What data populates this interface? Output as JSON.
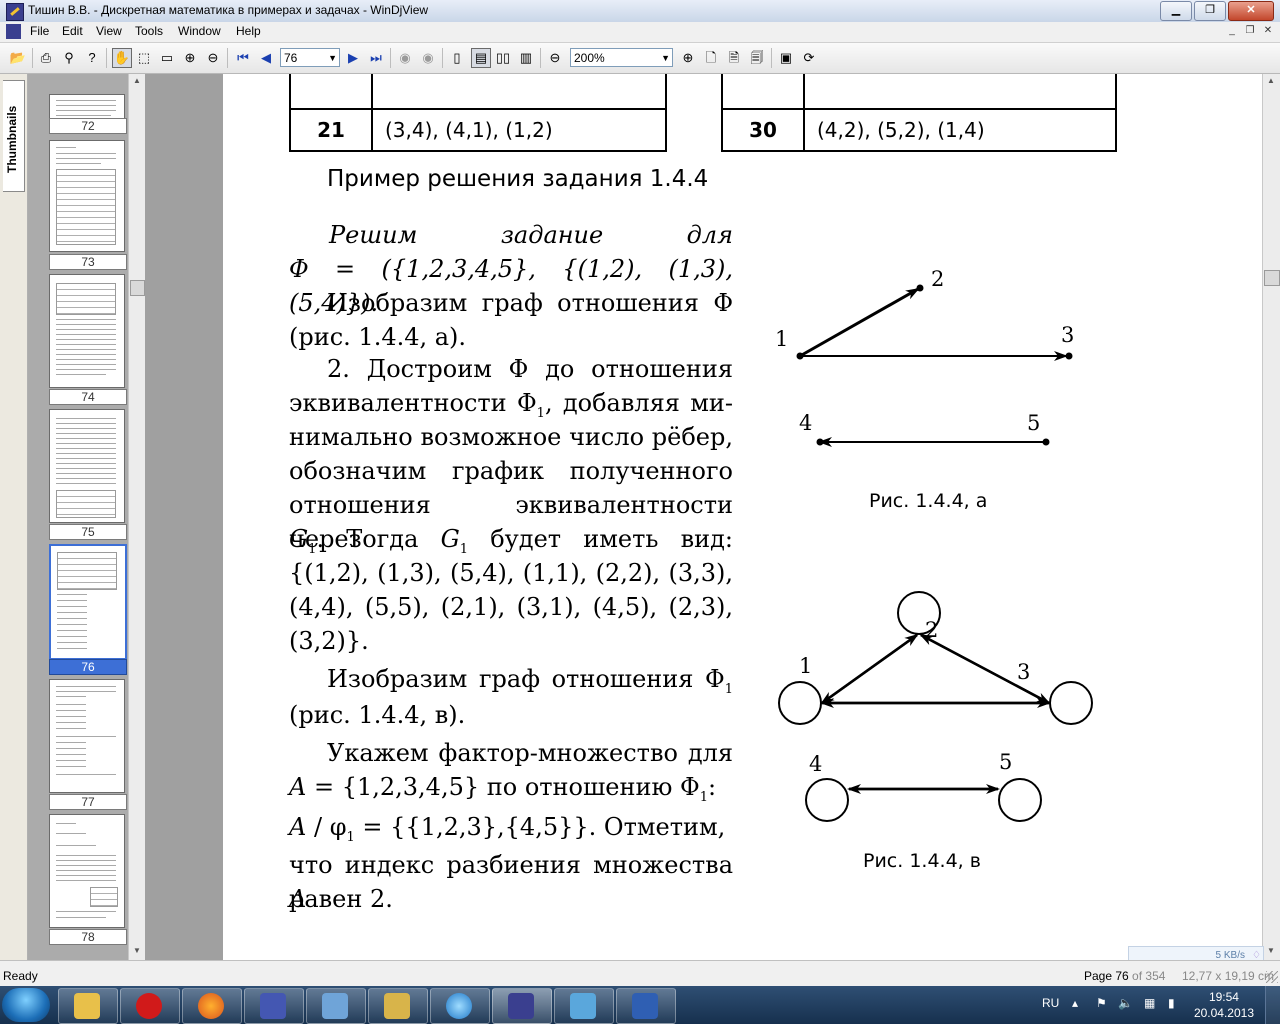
{
  "window": {
    "title": "Тишин В.В. - Дискретная математика в примерах и задачах - WinDjView"
  },
  "menu": {
    "items": [
      "File",
      "Edit",
      "View",
      "Tools",
      "Window",
      "Help"
    ]
  },
  "toolbar": {
    "page_number": "76",
    "zoom": "200%"
  },
  "thumbnails": {
    "tab_label": "Thumbnails",
    "labels": [
      "72",
      "73",
      "74",
      "75",
      "76",
      "77",
      "78"
    ],
    "selected": "76"
  },
  "page": {
    "table_rows": [
      {
        "num": "21",
        "value": "(3,4), (4,1), (1,2)"
      },
      {
        "num": "30",
        "value": "(4,2), (5,2), (1,4)"
      }
    ],
    "heading": "Пример решения задания 1.4.4",
    "p1_line1": [
      "Решим",
      "задание",
      "для"
    ],
    "p1_line2": "Φ = ({1,2,3,4,5}, {(1,2), (1,3), (5,4)}).",
    "p2_line1": "Изобразим граф отношения Φ",
    "p2_line2": "(рис. 1.4.4, а).",
    "p3_line1": "2. Достроим Φ до отношения",
    "p3_line2a": "эквивалентности Φ",
    "p3_line2b": ", добавляя ми-",
    "p3_line3": "нимально возможное число рёбер,",
    "p3_line4": "обозначим график полученного",
    "p3_line5": "отношения эквивалентности через",
    "p3_line6a": "G",
    "p3_line6b": ". Тогда ",
    "p3_line6c": "G",
    "p3_line6d": " будет иметь вид:",
    "p3_line7": "{(1,2), (1,3), (5,4), (1,1), (2,2), (3,3),",
    "p3_line8": "(4,4), (5,5), (2,1), (3,1), (4,5), (2,3),",
    "p3_line9": "(3,2)}.",
    "p4_line1a": "Изобразим граф отношения Φ",
    "p4_line2": "(рис. 1.4.4, в).",
    "p5_line1": "Укажем фактор-множество для",
    "p5_line2a": "A",
    "p5_line2b": " = {1,2,3,4,5}  по отношению Φ",
    "p5_line2c": ":",
    "p5_line3a": "A",
    "p5_line3b": " / φ",
    "p5_line3c": " = {{1,2,3},{4,5}}.   Отметим,",
    "p5_line4a": "что индекс разбиения множества ",
    "p5_line4b": "A",
    "p5_line5": "равен 2.",
    "subscript": "1",
    "caption_a": "Рис. 1.4.4, а",
    "caption_b": "Рис. 1.4.4, в",
    "graph_a_nodes": [
      "1",
      "2",
      "3",
      "4",
      "5"
    ],
    "graph_b_nodes": [
      "1",
      "2",
      "3",
      "4",
      "5"
    ]
  },
  "status": {
    "left": "Ready",
    "page_prefix": "Page 76",
    "page_suffix": " of 354",
    "size": "12,77 x 19,19 cm"
  },
  "network": {
    "speed": "5 KB/s"
  },
  "taskbar": {
    "lang": "RU",
    "time": "19:54",
    "date": "20.04.2013"
  }
}
